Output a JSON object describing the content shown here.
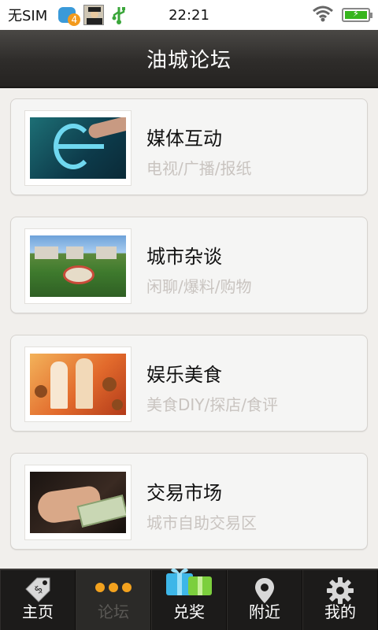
{
  "status_bar": {
    "sim_text": "无SIM",
    "badge_count": "4",
    "time": "22:21",
    "icons": [
      "notification-badge-icon",
      "avatar-icon",
      "usb-icon",
      "wifi-icon",
      "battery-charging-icon"
    ]
  },
  "header": {
    "title": "油城论坛"
  },
  "forums": [
    {
      "title": "媒体互动",
      "subtitle": "电视/广播/报纸",
      "thumb_icon": "media-interaction-image"
    },
    {
      "title": "城市杂谈",
      "subtitle": "闲聊/爆料/购物",
      "thumb_icon": "city-plaza-image"
    },
    {
      "title": "娱乐美食",
      "subtitle": "美食DIY/探店/食评",
      "thumb_icon": "food-cartoon-image"
    },
    {
      "title": "交易市场",
      "subtitle": "城市自助交易区",
      "thumb_icon": "cash-handover-image"
    }
  ],
  "tabs": [
    {
      "label": "主页",
      "icon": "price-tag-icon",
      "active": false
    },
    {
      "label": "论坛",
      "icon": "dots-icon",
      "active": true
    },
    {
      "label": "兑奖",
      "icon": "gift-box-icon",
      "active": false
    },
    {
      "label": "附近",
      "icon": "location-pin-icon",
      "active": false
    },
    {
      "label": "我的",
      "icon": "gear-icon",
      "active": false
    }
  ],
  "colors": {
    "header_bg": "#2e2c2a",
    "tab_bar_bg": "#1c1b1a",
    "accent_orange": "#f3a21e",
    "subtitle_gray": "#c9c4c0",
    "page_bg": "#f1efec"
  }
}
